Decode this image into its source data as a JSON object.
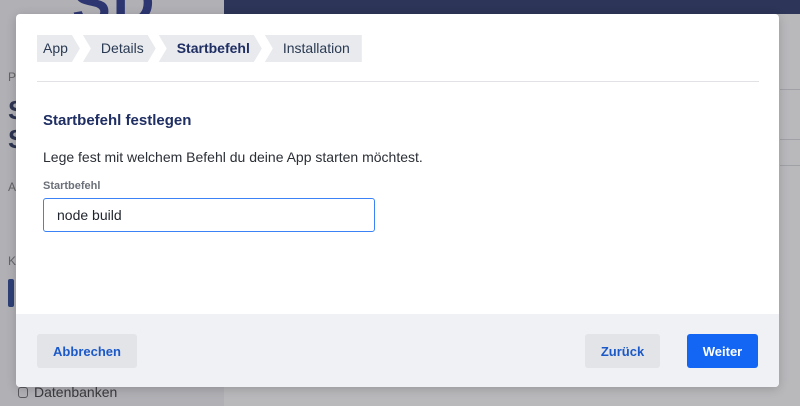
{
  "background": {
    "logo_text": "SD",
    "sidebar_letters": [
      "P",
      "S",
      "S",
      "A",
      "K"
    ],
    "sidebar_bottom_item": "Datenbanken",
    "sidebar_bottom_icon": "database-icon"
  },
  "breadcrumb": {
    "steps": [
      "App",
      "Details",
      "Startbefehl",
      "Installation"
    ],
    "active_index": 2
  },
  "dialog": {
    "title": "Startbefehl festlegen",
    "description": "Lege fest mit welchem Befehl du deine App starten möchtest.",
    "field_label": "Startbefehl",
    "field_value": "node build"
  },
  "footer": {
    "cancel_label": "Abbrechen",
    "back_label": "Zurück",
    "next_label": "Weiter"
  },
  "colors": {
    "primary": "#1366f3",
    "heading": "#1f2e63",
    "link": "#1c59c8"
  }
}
